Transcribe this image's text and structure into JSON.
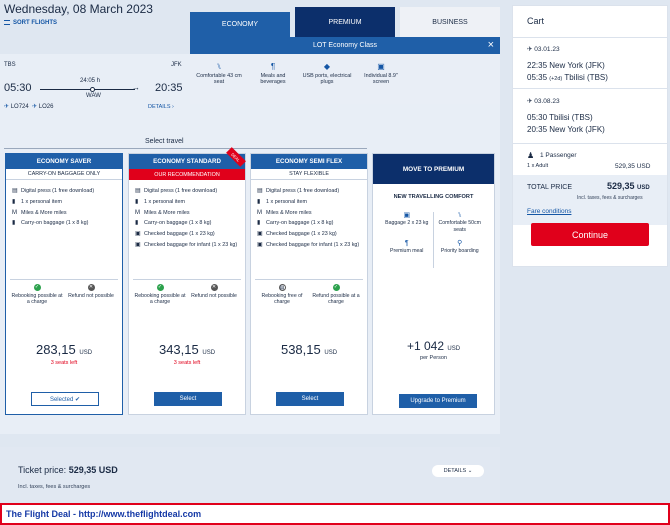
{
  "header": {
    "date": "Wednesday, 08 March 2023",
    "sort_label": "SORT FLIGHTS"
  },
  "tabs": [
    {
      "label": "ECONOMY"
    },
    {
      "label": "PREMIUM"
    },
    {
      "label": "BUSINESS"
    }
  ],
  "economy_panel": {
    "title": "LOT Economy Class",
    "close": "×",
    "features": [
      {
        "icon": "seat-icon",
        "label": "Comfortable 43 cm seat"
      },
      {
        "icon": "meal-icon",
        "label": "Meals and beverages"
      },
      {
        "icon": "plug-icon",
        "label": "USB ports, electrical plugs"
      },
      {
        "icon": "screen-icon",
        "label": "Individual 8.9\" screen"
      }
    ]
  },
  "flight": {
    "from": "TBS",
    "to": "JFK",
    "dep_time": "05:30",
    "arr_time": "20:35",
    "duration": "24:05 h",
    "via": "WAW",
    "codes": [
      "LO724",
      "LO26"
    ],
    "details": "DETAILS"
  },
  "select_travel": "Select travel",
  "fares": [
    {
      "name": "ECONOMY SAVER",
      "subtitle": "CARRY-ON BAGGAGE ONLY",
      "items": [
        "Digital press (1 free download)",
        "1 x personal item",
        "Miles & More miles",
        "Carry-on baggage  (1 x 8 kg)"
      ],
      "opt1": "Rebooking possible at a charge",
      "opt2": "Refund not possible",
      "price": "283,15",
      "currency": "USD",
      "seats": "3 seats left",
      "button": "Selected ✔"
    },
    {
      "name": "ECONOMY STANDARD",
      "badge": "DEAL",
      "subtitle": "OUR RECOMMENDATION",
      "items": [
        "Digital press (1 free download)",
        "1 x personal item",
        "Miles & More miles",
        "Carry-on baggage  (1 x 8 kg)",
        "Checked baggage (1 x 23 kg)",
        "Checked baggage for infant (1 x 23 kg)"
      ],
      "opt1": "Rebooking possible at a charge",
      "opt2": "Refund not possible",
      "price": "343,15",
      "currency": "USD",
      "seats": "3 seats left",
      "button": "Select"
    },
    {
      "name": "ECONOMY SEMI FLEX",
      "subtitle": "STAY FLEXIBLE",
      "items": [
        "Digital press (1 free download)",
        "1 x personal item",
        "Miles & More miles",
        "Carry-on baggage  (1 x 8 kg)",
        "Checked baggage (1 x 23 kg)",
        "Checked baggage for infant (1 x 23 kg)"
      ],
      "opt1": "Rebooking free of charge",
      "opt2": "Refund possible at a charge",
      "price": "538,15",
      "currency": "USD",
      "button": "Select"
    }
  ],
  "premium": {
    "title": "MOVE TO PREMIUM",
    "subtitle": "NEW TRAVELLING COMFORT",
    "features": [
      "Baggage 2 x 23 kg",
      "Comfortable 50cm seats",
      "Premium meal",
      "Priority boarding"
    ],
    "price": "+1 042",
    "currency": "USD",
    "per": "per Person",
    "button": "Upgrade to Premium"
  },
  "ticket": {
    "label": "Ticket price: ",
    "price": "529,35 USD",
    "sub": "Incl. taxes, fees & surcharges",
    "details": "DETAILS"
  },
  "cart": {
    "title": "Cart",
    "out_date": "03.01.23",
    "out_line1": "22:35  New York  (JFK)",
    "out_line2_time": "05:35",
    "out_line2_plus": "(+2d)",
    "out_line2_city": "Tbilisi  (TBS)",
    "ret_date": "03.08.23",
    "ret_line1": "05:30  Tbilisi  (TBS)",
    "ret_line2": "20:35  New York  (JFK)",
    "passengers": "1 Passenger",
    "adult": "1 x  Adult",
    "adult_price": "529,35 USD",
    "total_label": "TOTAL PRICE",
    "total_price": "529,35",
    "total_currency": "USD",
    "incl": "Incl. taxes, fees & surcharges",
    "fare_conditions": "Fare conditions",
    "continue": "Continue"
  },
  "banner": "The Flight Deal - http://www.theflightdeal.com",
  "colors": {
    "accent": "#1f5fa8",
    "dark": "#0c2f6b",
    "red": "#e0001b"
  }
}
